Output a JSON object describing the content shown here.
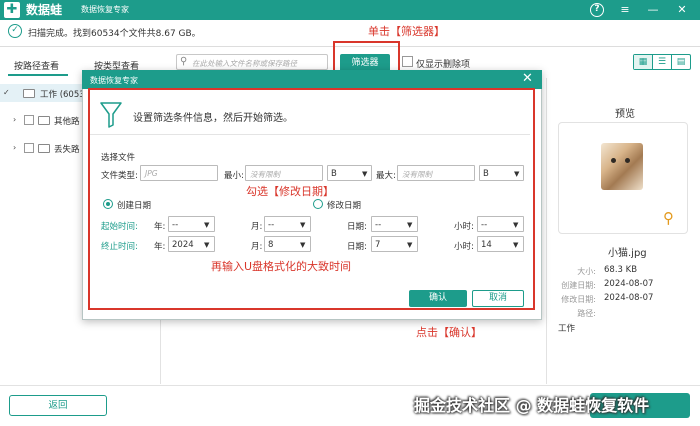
{
  "app": {
    "name": "数据蛙",
    "subtitle": "数据恢复专家"
  },
  "titlebar_icons": [
    "help-icon",
    "menu-icon",
    "minimize-icon",
    "close-icon"
  ],
  "scan": {
    "status": "扫描完成。找到60534个文件共8.67 GB。"
  },
  "tabs": {
    "by_path": "按路径查看",
    "by_type": "按类型查看"
  },
  "search": {
    "placeholder": "在此处输入文件名称或保存路径"
  },
  "filter_button": "筛选器",
  "deleted_only": "仅显示删除项",
  "tree": {
    "item1": "工作 (6053",
    "item2": "其他路",
    "item3": "丢失路"
  },
  "preview": {
    "title": "预览",
    "file_name": "小猫.jpg",
    "size_label": "大小:",
    "size_value": "68.3 KB",
    "created_label": "创建日期:",
    "created_value": "2024-08-07",
    "modified_label": "修改日期:",
    "modified_value": "2024-08-07",
    "path_label": "路径:",
    "path_value": "工作"
  },
  "bottom": {
    "back": "返回"
  },
  "watermark": "掘金技术社区 @ 数据蛙恢复软件",
  "annotations": {
    "click_filter": "单击【筛选器】",
    "check_modified": "勾选【修改日期】",
    "enter_time": "再输入U盘格式化的大致时间",
    "click_confirm": "点击【确认】"
  },
  "dialog": {
    "title": "数据恢复专家",
    "hint": "设置筛选条件信息，然后开始筛选。",
    "section": "选择文件",
    "file_type_label": "文件类型:",
    "file_type_placeholder": "JPG",
    "min_label": "最小:",
    "min_placeholder": "没有限制",
    "min_unit": "B",
    "max_label": "最大:",
    "max_placeholder": "没有限制",
    "max_unit": "B",
    "created_date": "创建日期",
    "modified_date": "修改日期",
    "start_label": "起始时间:",
    "end_label": "终止时间:",
    "year_label": "年:",
    "month_label": "月:",
    "day_label": "日期:",
    "hour_label": "小时:",
    "start": {
      "year": "--",
      "month": "--",
      "day": "--",
      "hour": "--"
    },
    "end": {
      "year": "2024",
      "month": "8",
      "day": "7",
      "hour": "14"
    },
    "ok": "确认",
    "cancel": "取消"
  }
}
